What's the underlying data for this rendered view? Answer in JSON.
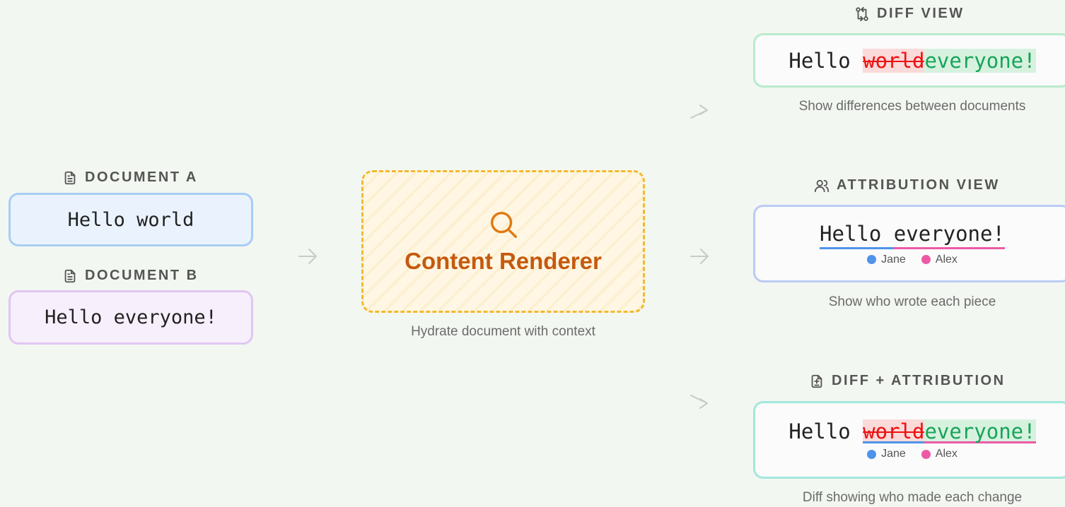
{
  "document_a": {
    "heading": "DOCUMENT A",
    "text": "Hello world"
  },
  "document_b": {
    "heading": "DOCUMENT B",
    "text": "Hello everyone!"
  },
  "renderer": {
    "title": "Content Renderer",
    "caption": "Hydrate document with context"
  },
  "diff_view": {
    "heading": "DIFF VIEW",
    "prefix": "Hello ",
    "deleted": "world",
    "inserted": "everyone!",
    "caption": "Show differences between documents"
  },
  "attribution_view": {
    "heading": "ATTRIBUTION VIEW",
    "text": "Hello everyone!",
    "caption": "Show who wrote each piece"
  },
  "diff_attribution": {
    "heading": "DIFF + ATTRIBUTION",
    "prefix": "Hello ",
    "deleted": "world",
    "inserted": "everyone!",
    "caption": "Diff showing who made each change"
  },
  "authors": [
    {
      "name": "Jane",
      "color": "#4f93ea"
    },
    {
      "name": "Alex",
      "color": "#ec5aa6"
    }
  ],
  "colors": {
    "doc_a_border": "#a9cdf3",
    "doc_a_bg": "#eaf3fd",
    "doc_b_border": "#e0c6f1",
    "doc_b_bg": "#f7effc",
    "renderer_border": "#f2b930",
    "renderer_text": "#c55a0f",
    "diff_border": "#b9ebcd",
    "attrib_border": "#bccbf4",
    "combo_border": "#a3e7dc"
  }
}
